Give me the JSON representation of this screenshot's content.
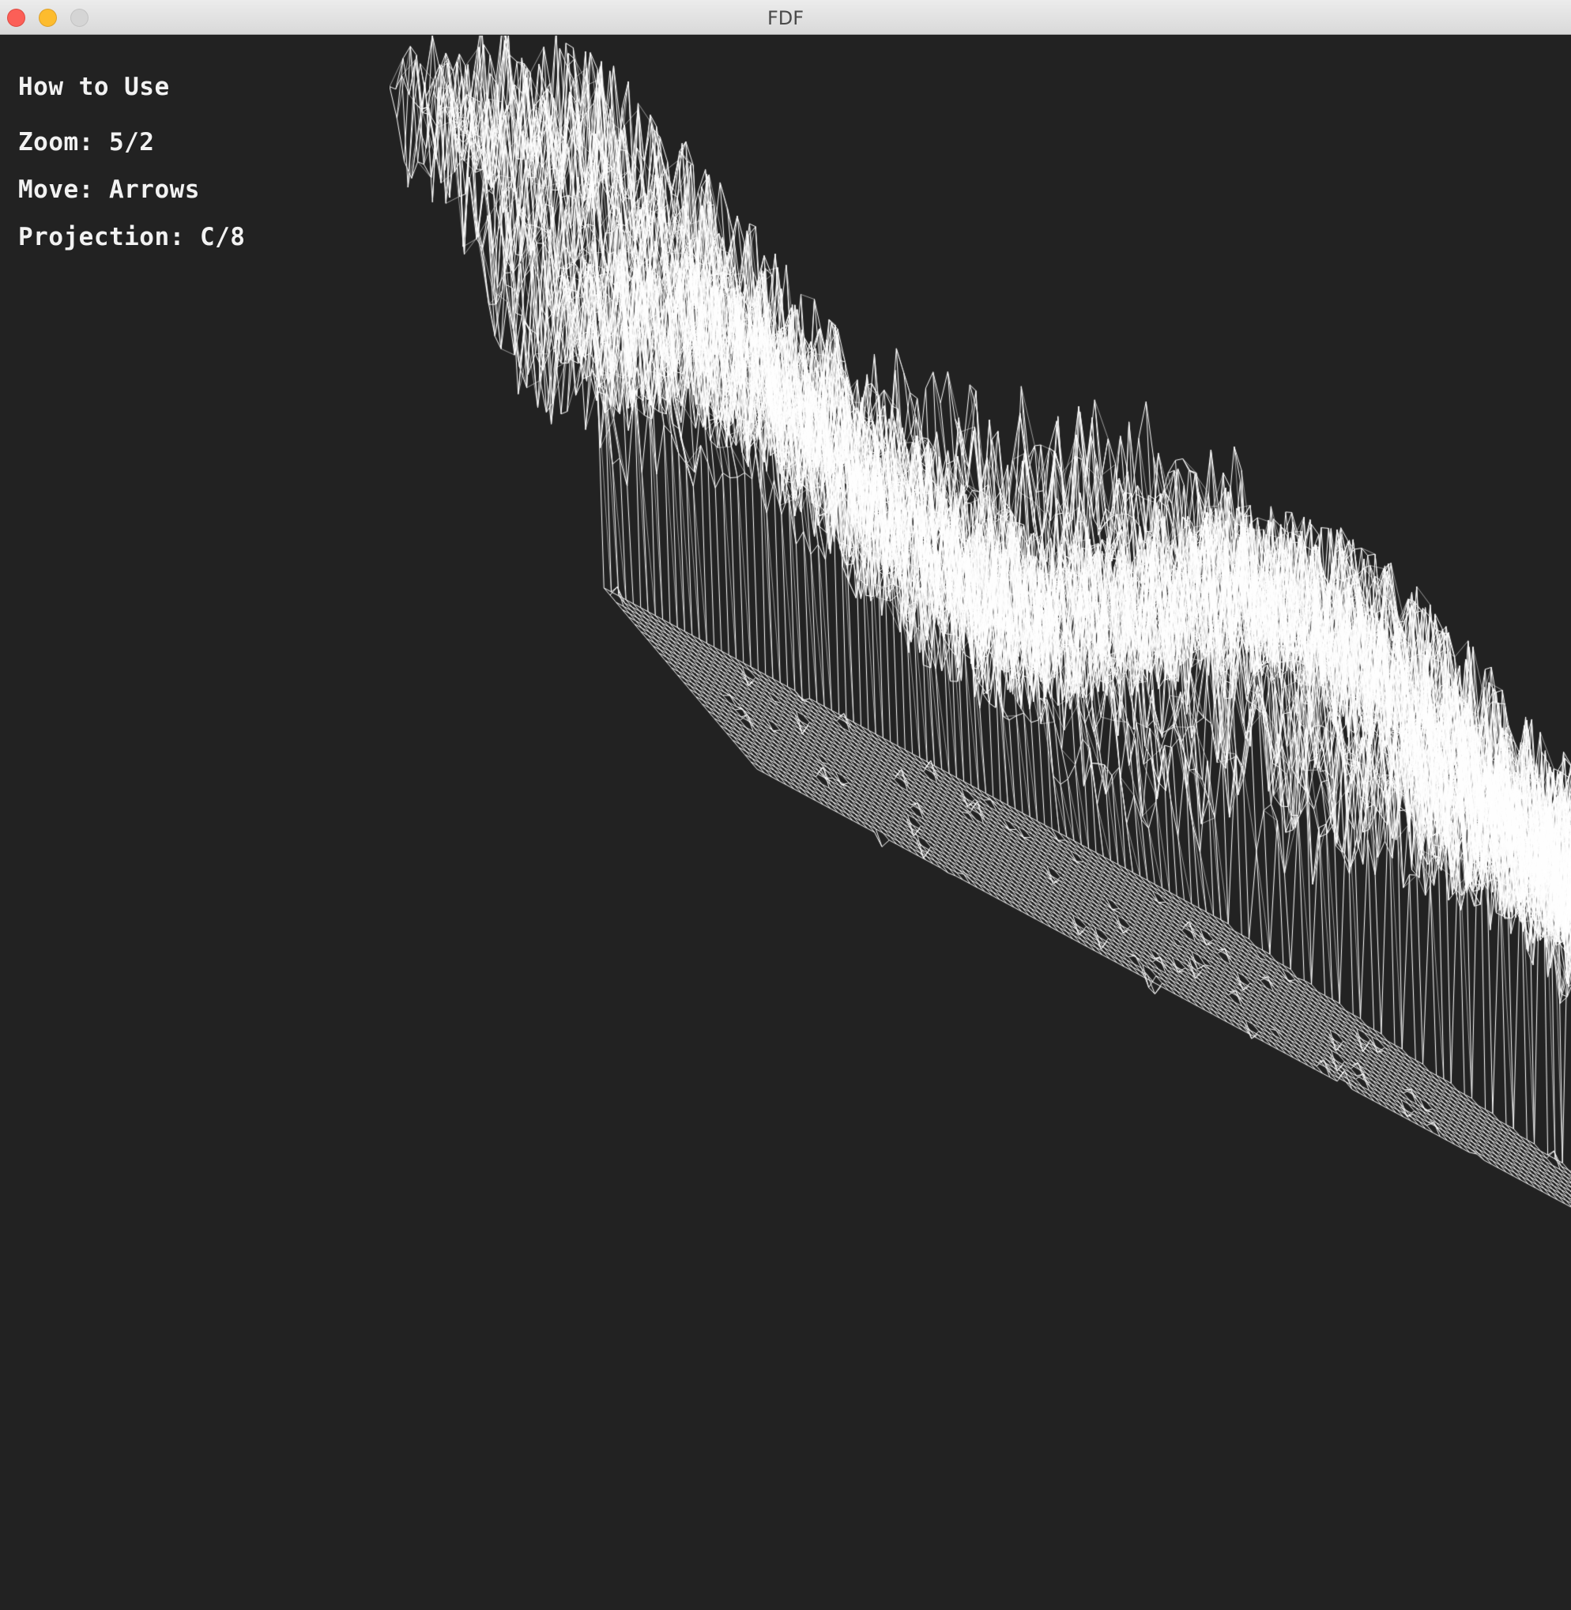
{
  "window": {
    "title": "FDF"
  },
  "help": {
    "title": "How to Use",
    "zoom": "Zoom: 5/2",
    "move": "Move: Arrows",
    "projection": "Projection: C/8"
  },
  "colors": {
    "background": "#222222",
    "wire": "#ffffff",
    "text": "#f2f2f2",
    "close": "#fc5f57",
    "minimize": "#fdbc2e",
    "maximize": "#d5d5d5"
  },
  "icons": {
    "close": "close-dot-icon",
    "minimize": "minimize-dot-icon",
    "maximize": "maximize-dot-icon"
  }
}
